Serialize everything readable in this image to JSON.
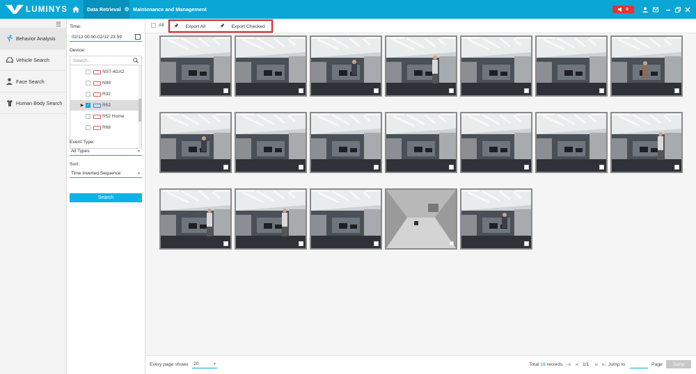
{
  "topbar": {
    "logo_text": "LUMINYS",
    "tabs": [
      {
        "label": "Data Retrieval"
      },
      {
        "label": "Maintenance and Management"
      }
    ],
    "alarm_count": "0",
    "colors": {
      "bar": "#0aa6d6",
      "active_tab": "#0791bd",
      "alarm": "#e63232"
    }
  },
  "leftnav": {
    "items": [
      {
        "label": "Behavior Analysis",
        "icon": "behavior-icon",
        "active": true
      },
      {
        "label": "Vehicle Search",
        "icon": "car-icon"
      },
      {
        "label": "Face Search",
        "icon": "person-icon"
      },
      {
        "label": "Human Body Search",
        "icon": "human-body-icon"
      }
    ]
  },
  "filter": {
    "time_label": "Time:",
    "time_value": "02/12 00:00-02/12 23:59",
    "device_label": "Device:",
    "device_search_placeholder": "Search...",
    "devices": [
      {
        "label": "NST-4DA2",
        "checked": false,
        "type": "dvr-red"
      },
      {
        "label": "N98",
        "checked": false,
        "type": "dvr-red"
      },
      {
        "label": "R32",
        "checked": false,
        "type": "dvr-red"
      },
      {
        "label": "R52",
        "checked": true,
        "type": "dvr-blue",
        "expandable": true,
        "selected": true
      },
      {
        "label": "R52 Home",
        "checked": false,
        "type": "dvr-red"
      },
      {
        "label": "R68",
        "checked": false,
        "type": "dvr-red"
      }
    ],
    "event_type_label": "Event Type:",
    "event_type_value": "All Types",
    "sort_label": "Sort:",
    "sort_value": "Time Inverted Sequence",
    "search_button": "Search"
  },
  "toolbar": {
    "all_label": "All",
    "export_all": "Export All",
    "export_checked": "Export Checked"
  },
  "results": {
    "count": 19
  },
  "footer": {
    "per_page_label": "Every page shows",
    "per_page_value": "20",
    "total_prefix": "Total ",
    "total_count": "19",
    "total_suffix": " records.",
    "page_info": "1/1",
    "jump_to_label": "Jump to",
    "page_label": "Page",
    "jump_button": "Jump"
  }
}
